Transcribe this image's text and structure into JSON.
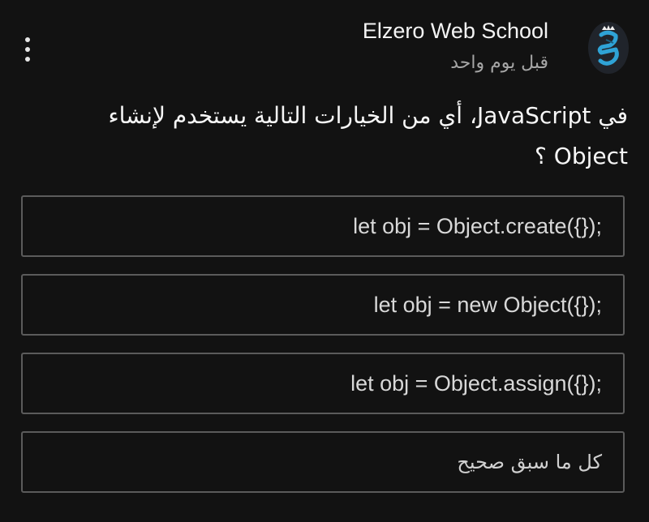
{
  "post": {
    "author": "Elzero Web School",
    "time": "قبل يوم واحد",
    "avatar_icon": "elzero-logo-icon",
    "menu_icon": "more-vertical-icon"
  },
  "question": {
    "line1": "في JavaScript، أي من الخيارات التالية يستخدم لإنشاء",
    "line2": "Object ؟"
  },
  "options": [
    {
      "label": "let obj = Object.create({});"
    },
    {
      "label": "let obj = new Object({});"
    },
    {
      "label": "let obj = Object.assign({});"
    },
    {
      "label": "كل ما سبق صحيح"
    }
  ],
  "colors": {
    "background": "#121212",
    "option_border": "#5b5b5b",
    "logo_blue": "#2fa3d6"
  }
}
